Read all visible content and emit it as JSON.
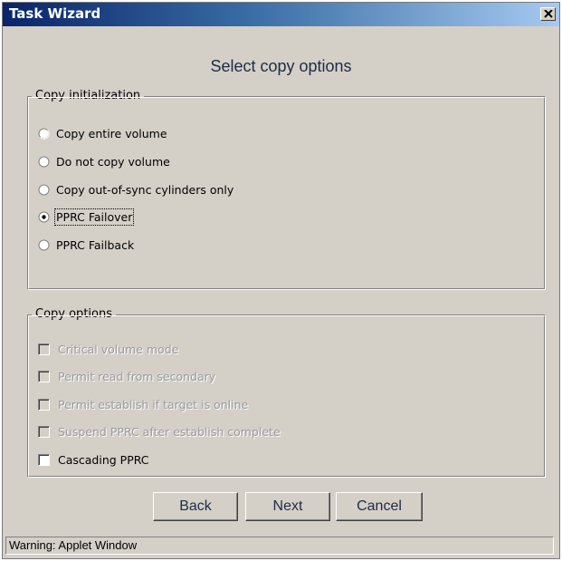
{
  "window": {
    "title": "Task Wizard",
    "close_icon": "close-icon"
  },
  "heading": "Select copy options",
  "copy_initialization": {
    "legend": "Copy initialization",
    "options": [
      {
        "label": "Copy entire volume",
        "selected": false
      },
      {
        "label": "Do not copy volume",
        "selected": false
      },
      {
        "label": "Copy out-of-sync cylinders only",
        "selected": false
      },
      {
        "label": "PPRC Failover",
        "selected": true
      },
      {
        "label": "PPRC Failback",
        "selected": false
      }
    ]
  },
  "copy_options": {
    "legend": "Copy options",
    "options": [
      {
        "label": "Critical volume mode",
        "checked": false,
        "enabled": false
      },
      {
        "label": "Permit read from secondary",
        "checked": false,
        "enabled": false
      },
      {
        "label": "Permit establish if target is online",
        "checked": false,
        "enabled": false
      },
      {
        "label": "Suspend PPRC after establish complete",
        "checked": false,
        "enabled": false
      },
      {
        "label": "Cascading PPRC",
        "checked": false,
        "enabled": true
      }
    ]
  },
  "buttons": {
    "back": "Back",
    "next": "Next",
    "cancel": "Cancel"
  },
  "status": "Warning: Applet Window"
}
